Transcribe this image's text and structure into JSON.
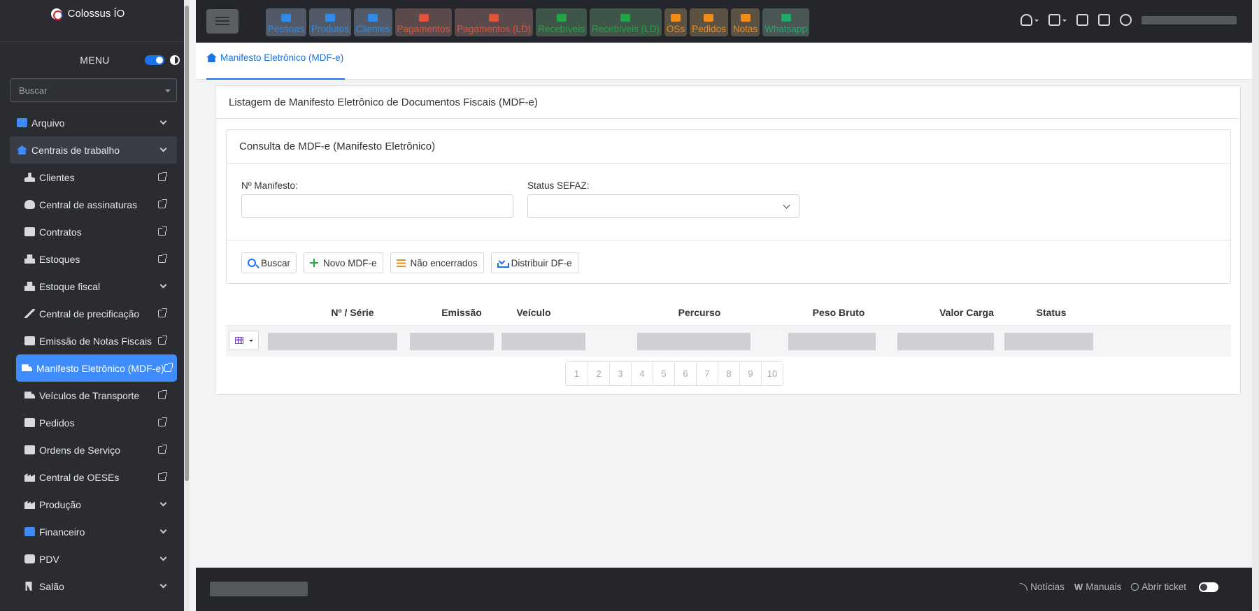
{
  "app": {
    "name": "Colossus ÍO"
  },
  "sidebar": {
    "menu_label": "MENU",
    "search_placeholder": "Buscar",
    "items": [
      {
        "label": "Arquivo",
        "icon": "folder-icon",
        "kind": "chevron"
      },
      {
        "label": "Centrais de trabalho",
        "icon": "home-icon",
        "kind": "chevron"
      },
      {
        "label": "Clientes",
        "icon": "person-icon",
        "kind": "external"
      },
      {
        "label": "Central de assinaturas",
        "icon": "headset-icon",
        "kind": "external"
      },
      {
        "label": "Contratos",
        "icon": "document-icon",
        "kind": "external"
      },
      {
        "label": "Estoques",
        "icon": "boxes-icon",
        "kind": "external"
      },
      {
        "label": "Estoque fiscal",
        "icon": "boxes-icon",
        "kind": "chevron"
      },
      {
        "label": "Central de precificação",
        "icon": "percent-icon",
        "kind": "external"
      },
      {
        "label": "Emissão de Notas Fiscais",
        "icon": "invoice-icon",
        "kind": "external"
      },
      {
        "label": "Manifesto Eletrônico (MDF-e)",
        "icon": "truck-icon",
        "kind": "external"
      },
      {
        "label": "Veículos de Transporte",
        "icon": "truck-icon",
        "kind": "external"
      },
      {
        "label": "Pedidos",
        "icon": "id-card-icon",
        "kind": "external"
      },
      {
        "label": "Ordens de Serviço",
        "icon": "edit-icon",
        "kind": "external"
      },
      {
        "label": "Central de OESEs",
        "icon": "factory-icon",
        "kind": "external"
      },
      {
        "label": "Produção",
        "icon": "factory-icon",
        "kind": "chevron"
      },
      {
        "label": "Financeiro",
        "icon": "folder-icon",
        "kind": "chevron"
      },
      {
        "label": "PDV",
        "icon": "cash-register-icon",
        "kind": "chevron"
      },
      {
        "label": "Salão",
        "icon": "utensils-icon",
        "kind": "chevron"
      }
    ]
  },
  "topbar": {
    "shortcuts": [
      {
        "label": "Pessoas",
        "color": "blue"
      },
      {
        "label": "Produtos",
        "color": "blue"
      },
      {
        "label": "Clientes",
        "color": "blue"
      },
      {
        "label": "Pagamentos",
        "color": "red"
      },
      {
        "label": "Pagamentos (LD)",
        "color": "red"
      },
      {
        "label": "Recebíveis",
        "color": "green"
      },
      {
        "label": "Recebíveis (LD)",
        "color": "green"
      },
      {
        "label": "OSs",
        "color": "orange"
      },
      {
        "label": "Pedidos",
        "color": "orange"
      },
      {
        "label": "Notas",
        "color": "orange"
      },
      {
        "label": "Whatsapp",
        "color": "teal"
      }
    ]
  },
  "breadcrumb": {
    "label": "Manifesto Eletrônico (MDF-e)"
  },
  "main": {
    "card_title": "Listagem de Manifesto Eletrônico de Documentos Fiscais (MDF-e)",
    "filter_title": "Consulta de MDF-e (Manifesto Eletrônico)",
    "fields": {
      "manifesto_label": "Nº Manifesto:",
      "manifesto_value": "",
      "status_label": "Status SEFAZ:",
      "status_value": ""
    },
    "buttons": {
      "search": "Buscar",
      "new": "Novo MDF-e",
      "open": "Não encerrados",
      "distribute": "Distribuir DF-e"
    },
    "table": {
      "columns": [
        "Nº / Série",
        "Emissão",
        "Veículo",
        "Percurso",
        "Peso Bruto",
        "Valor Carga",
        "Status"
      ]
    },
    "pagination": [
      "1",
      "2",
      "3",
      "4",
      "5",
      "6",
      "7",
      "8",
      "9",
      "10"
    ]
  },
  "footer": {
    "news": "Notícias",
    "manuals": "Manuais",
    "ticket": "Abrir ticket"
  },
  "colors": {
    "accent": "#3f8cff",
    "sidebar_bg": "#2a2c31",
    "topbar_bg": "#24262b"
  }
}
